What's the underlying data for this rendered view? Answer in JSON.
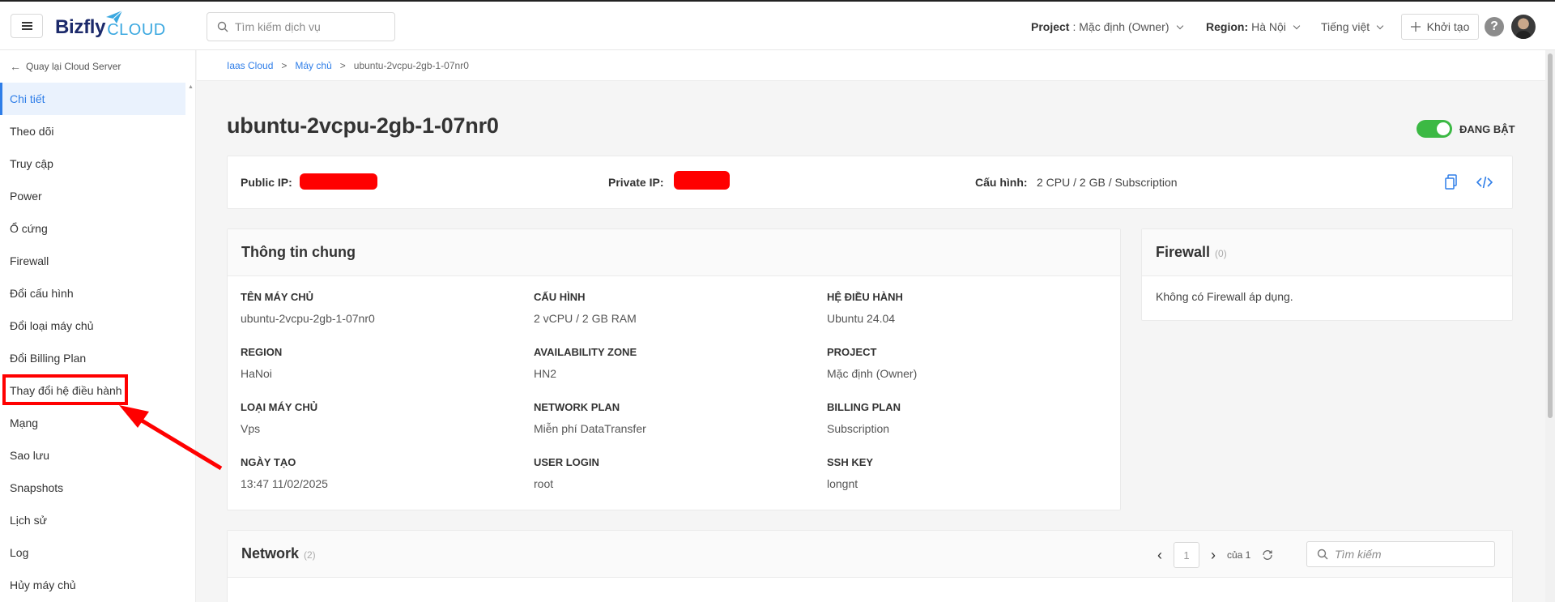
{
  "header": {
    "logo_main": "Bizfly",
    "logo_sub": "CLOUD",
    "search_placeholder": "Tìm kiếm dịch vụ",
    "project_label": "Project",
    "project_value": ": Mặc định (Owner)",
    "region_label": "Region:",
    "region_value": "Hà Nội",
    "language": "Tiếng việt",
    "create_label": "Khởi tạo",
    "help": "?"
  },
  "sidebar": {
    "back_label": "Quay lại Cloud Server",
    "items": [
      {
        "label": "Chi tiết"
      },
      {
        "label": "Theo dõi"
      },
      {
        "label": "Truy cập"
      },
      {
        "label": "Power"
      },
      {
        "label": "Ổ cứng"
      },
      {
        "label": "Firewall"
      },
      {
        "label": "Đổi cấu hình"
      },
      {
        "label": "Đổi loại máy chủ"
      },
      {
        "label": "Đổi Billing Plan"
      },
      {
        "label": "Thay đổi hệ điều hành"
      },
      {
        "label": "Mạng"
      },
      {
        "label": "Sao lưu"
      },
      {
        "label": "Snapshots"
      },
      {
        "label": "Lịch sử"
      },
      {
        "label": "Log"
      },
      {
        "label": "Hủy máy chủ"
      }
    ]
  },
  "breadcrumb": {
    "root": "Iaas Cloud",
    "parent": "Máy chủ",
    "current": "ubuntu-2vcpu-2gb-1-07nr0",
    "sep": ">"
  },
  "server": {
    "name": "ubuntu-2vcpu-2gb-1-07nr0",
    "status": "ĐANG BẬT",
    "public_ip_label": "Public IP:",
    "private_ip_label": "Private IP:",
    "config_label": "Cấu hình:",
    "config_value": "2 CPU / 2 GB / Subscription"
  },
  "general_info": {
    "title": "Thông tin chung",
    "fields": [
      {
        "key": "TÊN MÁY CHỦ",
        "value": "ubuntu-2vcpu-2gb-1-07nr0"
      },
      {
        "key": "CẤU HÌNH",
        "value": "2 vCPU / 2 GB RAM"
      },
      {
        "key": "HỆ ĐIỀU HÀNH",
        "value": "Ubuntu 24.04"
      },
      {
        "key": "REGION",
        "value": "HaNoi"
      },
      {
        "key": "AVAILABILITY ZONE",
        "value": "HN2"
      },
      {
        "key": "PROJECT",
        "value": "Mặc định (Owner)"
      },
      {
        "key": "LOẠI MÁY CHỦ",
        "value": "Vps"
      },
      {
        "key": "NETWORK PLAN",
        "value": "Miễn phí DataTransfer"
      },
      {
        "key": "BILLING PLAN",
        "value": "Subscription"
      },
      {
        "key": "NGÀY TẠO",
        "value": "13:47 11/02/2025"
      },
      {
        "key": "USER LOGIN",
        "value": "root"
      },
      {
        "key": "SSH KEY",
        "value": "longnt"
      }
    ]
  },
  "firewall": {
    "title": "Firewall",
    "count": "(0)",
    "empty_text": "Không có Firewall áp dụng."
  },
  "network": {
    "title": "Network",
    "count": "(2)",
    "page": "1",
    "of_label": "của 1",
    "search_placeholder": "Tìm kiếm"
  },
  "colors": {
    "accent": "#2f7ee8",
    "status_on": "#3cb944",
    "annotation": "#ff0000"
  }
}
